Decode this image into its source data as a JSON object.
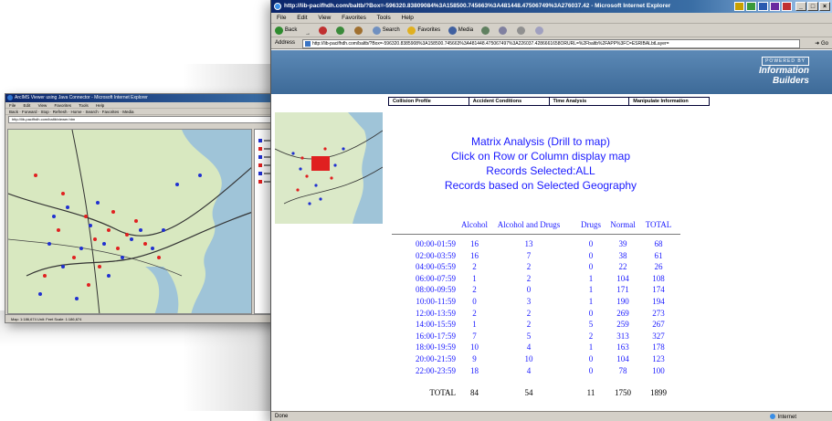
{
  "main_window": {
    "title": "http://lib-pacifhdh.com/baltb/?Box=-596320.83809084%3A158500.745663%3A481448.47506749%3A276037.42 - Microsoft Internet Explorer",
    "menu": [
      "File",
      "Edit",
      "View",
      "Favorites",
      "Tools",
      "Help"
    ],
    "toolbar": {
      "back": "Back",
      "forward": "→",
      "search": "Search",
      "favorites": "Favorites",
      "media": "Media"
    },
    "address_label": "Address",
    "address_url": "http://lib-pacifhdh.com/baltb/?Box=-596320.8385908%3A158500.745663%3A481448.475067497%3A226037.4286661658ORURL=%2Fbaltb%2FAPP%3FC=ESRIBALbtLayer=",
    "go_label": "Go",
    "brand_powered": "POWERED BY",
    "brand_name_1": "Information",
    "brand_name_2": "Builders",
    "tabs": [
      "Collision Profile",
      "Accident Conditions",
      "Time Analysis",
      "Manipulate Information"
    ],
    "heading": {
      "line1": "Matrix Analysis (Drill to map)",
      "line2": "Click on Row or Column display map",
      "line3": "Records Selected:ALL",
      "line4": "Records based on Selected Geography"
    },
    "matrix": {
      "columns": [
        "Alcohol",
        "Alcohol and Drugs",
        "Drugs",
        "Normal",
        "TOTAL"
      ],
      "rows": [
        {
          "label": "00:00-01:59",
          "values": [
            "16",
            "13",
            "0",
            "39",
            "68"
          ]
        },
        {
          "label": "02:00-03:59",
          "values": [
            "16",
            "7",
            "0",
            "38",
            "61"
          ]
        },
        {
          "label": "04:00-05:59",
          "values": [
            "2",
            "2",
            "0",
            "22",
            "26"
          ]
        },
        {
          "label": "06:00-07:59",
          "values": [
            "1",
            "2",
            "1",
            "104",
            "108"
          ]
        },
        {
          "label": "08:00-09:59",
          "values": [
            "2",
            "0",
            "1",
            "171",
            "174"
          ]
        },
        {
          "label": "10:00-11:59",
          "values": [
            "0",
            "3",
            "1",
            "190",
            "194"
          ]
        },
        {
          "label": "12:00-13:59",
          "values": [
            "2",
            "2",
            "0",
            "269",
            "273"
          ]
        },
        {
          "label": "14:00-15:59",
          "values": [
            "1",
            "2",
            "5",
            "259",
            "267"
          ]
        },
        {
          "label": "16:00-17:59",
          "values": [
            "7",
            "5",
            "2",
            "313",
            "327"
          ]
        },
        {
          "label": "18:00-19:59",
          "values": [
            "10",
            "4",
            "1",
            "163",
            "178"
          ]
        },
        {
          "label": "20:00-21:59",
          "values": [
            "9",
            "10",
            "0",
            "104",
            "123"
          ]
        },
        {
          "label": "22:00-23:59",
          "values": [
            "18",
            "4",
            "0",
            "78",
            "100"
          ]
        }
      ],
      "total": {
        "label": "TOTAL",
        "values": [
          "84",
          "54",
          "11",
          "1750",
          "1899"
        ]
      }
    },
    "status": "Done",
    "zone": "Internet"
  },
  "back_window": {
    "title": "ArcIMS Viewer using Java Connector - Microsoft Internet Explorer",
    "menu": [
      "File",
      "Edit",
      "View",
      "Favorites",
      "Tools",
      "Help"
    ],
    "toolbar_text": "Back  ·  Forward  ·  Stop  ·  Refresh  ·  Home  ·  Search  ·  Favorites  ·  Media",
    "address_url": "http://lib-pacifhdh.com/baltb/viewer.htm",
    "status": "Map: 1:186,674    Unit: Feet    Scale: 1:186,674"
  },
  "colors": {
    "link_blue": "#1a1aff",
    "banner": "#4a77a6",
    "titlebar": "#0a246a",
    "map_land": "#d8e8c0",
    "map_water": "#9fc4d8",
    "accident_red": "#e02020",
    "accident_blue": "#2030d0"
  }
}
